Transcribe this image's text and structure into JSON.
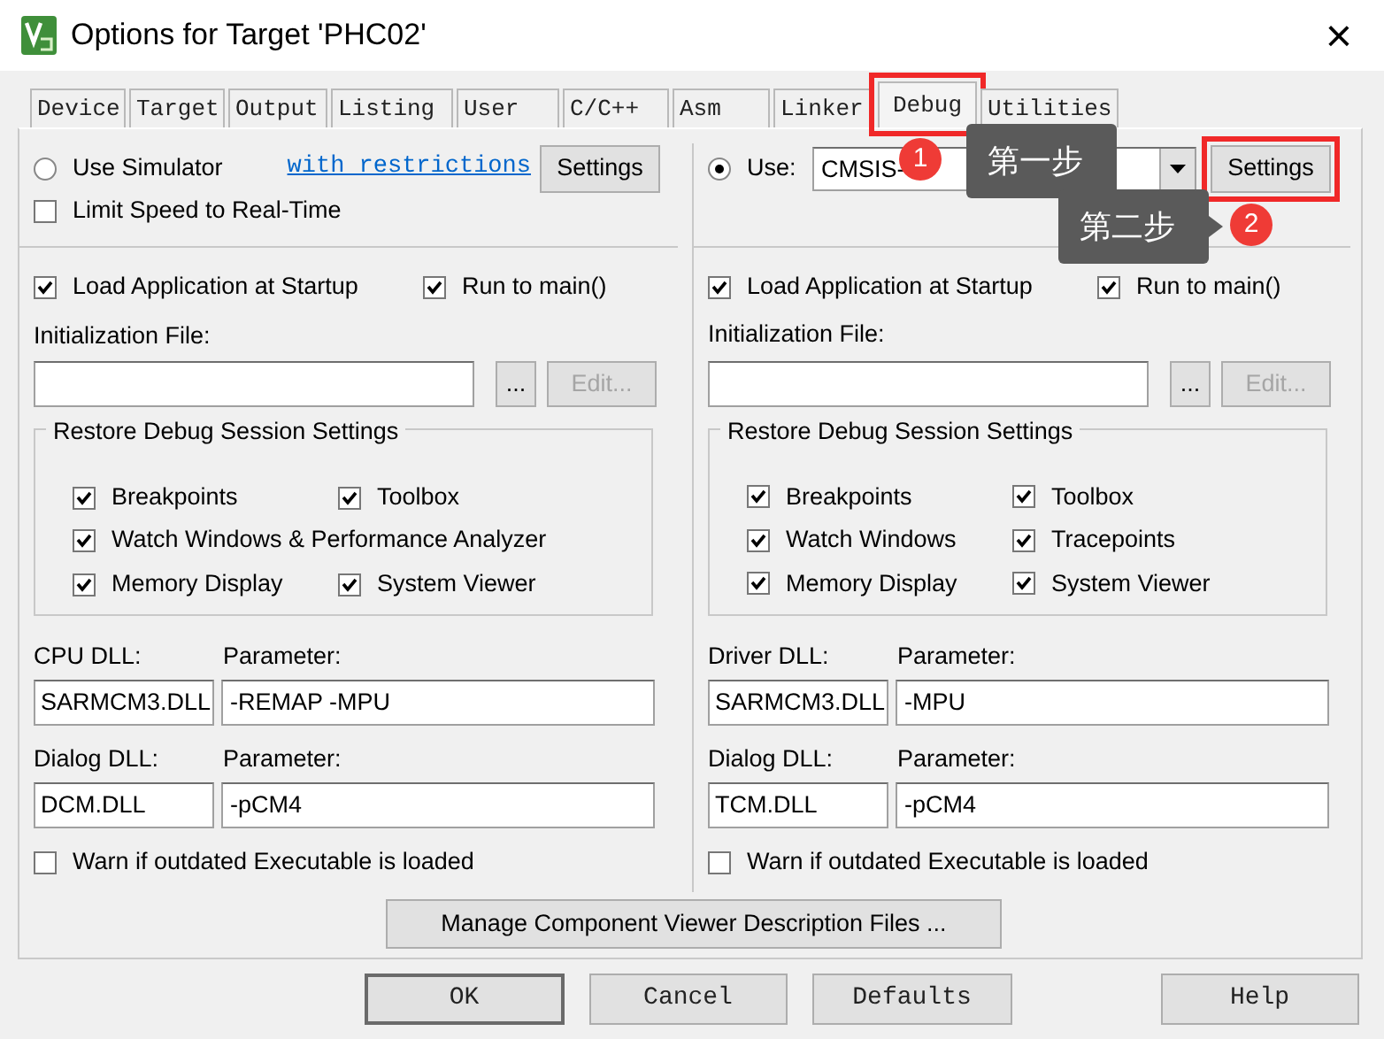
{
  "window": {
    "title": "Options for Target 'PHC02'",
    "close": "×"
  },
  "tabs": [
    {
      "label": "Device",
      "selected": false,
      "highlighted": false
    },
    {
      "label": "Target",
      "selected": false,
      "highlighted": false
    },
    {
      "label": "Output",
      "selected": false,
      "highlighted": false
    },
    {
      "label": "Listing",
      "selected": false,
      "highlighted": false
    },
    {
      "label": "User",
      "selected": false,
      "highlighted": false
    },
    {
      "label": "C/C++",
      "selected": false,
      "highlighted": false
    },
    {
      "label": "Asm",
      "selected": false,
      "highlighted": false
    },
    {
      "label": "Linker",
      "selected": false,
      "highlighted": false
    },
    {
      "label": "Debug",
      "selected": true,
      "highlighted": true
    },
    {
      "label": "Utilities",
      "selected": false,
      "highlighted": false
    }
  ],
  "panes": [
    {
      "mode": {
        "kind": "simulator",
        "label": "Use Simulator",
        "selected": false,
        "link": "with restrictions",
        "settings_button": "Settings",
        "settings_highlighted": false,
        "limit_speed": {
          "label": "Limit Speed to Real-Time",
          "checked": false
        }
      },
      "load_app": {
        "label": "Load Application at Startup",
        "checked": true
      },
      "run_to_main": {
        "label": "Run to main()",
        "checked": true
      },
      "init_label": "Initialization File:",
      "browse_button": "...",
      "edit_button": {
        "label": "Edit...",
        "disabled": true
      },
      "restore": {
        "title": "Restore Debug Session Settings",
        "rows": [
          [
            {
              "label": "Breakpoints",
              "checked": true
            },
            {
              "label": "Toolbox",
              "checked": true
            }
          ],
          [
            {
              "label": "Watch Windows & Performance Analyzer",
              "checked": true
            }
          ],
          [
            {
              "label": "Memory Display",
              "checked": true
            },
            {
              "label": "System Viewer",
              "checked": true
            }
          ]
        ]
      },
      "dll_label": "CPU DLL:",
      "dll_param_label": "Parameter:",
      "dll": "SARMCM3.DLL",
      "dll_param": "-REMAP -MPU",
      "dialog_label": "Dialog DLL:",
      "dialog_param_label": "Parameter:",
      "dialog": "DCM.DLL",
      "dialog_param": "-pCM4",
      "warn": {
        "label": "Warn if outdated Executable is loaded",
        "checked": false
      }
    },
    {
      "mode": {
        "kind": "driver",
        "label": "Use:",
        "selected": true,
        "value": "CMSIS-",
        "settings_button": "Settings",
        "settings_highlighted": true
      },
      "load_app": {
        "label": "Load Application at Startup",
        "checked": true
      },
      "run_to_main": {
        "label": "Run to main()",
        "checked": true
      },
      "init_label": "Initialization File:",
      "browse_button": "...",
      "edit_button": {
        "label": "Edit...",
        "disabled": true
      },
      "restore": {
        "title": "Restore Debug Session Settings",
        "rows": [
          [
            {
              "label": "Breakpoints",
              "checked": true
            },
            {
              "label": "Toolbox",
              "checked": true
            }
          ],
          [
            {
              "label": "Watch Windows",
              "checked": true
            },
            {
              "label": "Tracepoints",
              "checked": true
            }
          ],
          [
            {
              "label": "Memory Display",
              "checked": true
            },
            {
              "label": "System Viewer",
              "checked": true
            }
          ]
        ]
      },
      "dll_label": "Driver DLL:",
      "dll_param_label": "Parameter:",
      "dll": "SARMCM3.DLL",
      "dll_param": "-MPU",
      "dialog_label": "Dialog DLL:",
      "dialog_param_label": "Parameter:",
      "dialog": "TCM.DLL",
      "dialog_param": "-pCM4",
      "warn": {
        "label": "Warn if outdated Executable is loaded",
        "checked": false
      }
    }
  ],
  "manage_button": "Manage Component Viewer Description Files ...",
  "buttons": [
    {
      "label": "OK",
      "default": true
    },
    {
      "label": "Cancel",
      "default": false
    },
    {
      "label": "Defaults",
      "default": false
    },
    {
      "label": "Help",
      "default": false
    }
  ],
  "callouts": [
    {
      "number": "1",
      "text": "第一步"
    },
    {
      "number": "2",
      "text": "第二步"
    }
  ]
}
